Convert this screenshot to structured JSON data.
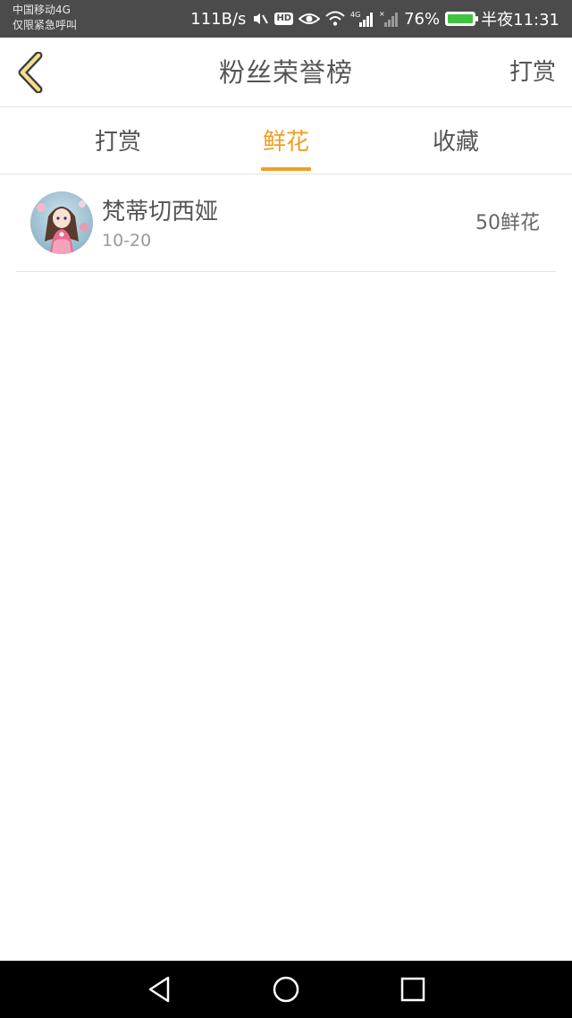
{
  "status_bar": {
    "carrier_line1": "中国移动4G",
    "carrier_line2": "仅限紧急呼叫",
    "net_speed": "111B/s",
    "hd_label": "HD",
    "network_type": "4G",
    "battery_percent": "76%",
    "battery_level": 0.76,
    "time": "半夜11:31",
    "icons": [
      "mute-icon",
      "hd-icon",
      "eye-icon",
      "wifi-icon",
      "signal-icon",
      "signal-off-icon",
      "battery-icon"
    ]
  },
  "header": {
    "back_icon": "chevron-left-icon",
    "title": "粉丝荣誉榜",
    "action_label": "打赏"
  },
  "tabs": [
    {
      "label": "打赏",
      "active": false
    },
    {
      "label": "鲜花",
      "active": true
    },
    {
      "label": "收藏",
      "active": false
    }
  ],
  "list": [
    {
      "name": "梵蒂切西娅",
      "date": "10-20",
      "amount": "50鲜花"
    }
  ],
  "nav": {
    "icons": [
      "back-triangle-icon",
      "home-circle-icon",
      "recent-square-icon"
    ]
  },
  "colors": {
    "accent": "#f0a020",
    "status_bar_bg": "#4b4b4b",
    "nav_bar_bg": "#000000",
    "text": "#555555",
    "divider": "#e3e3e3"
  }
}
